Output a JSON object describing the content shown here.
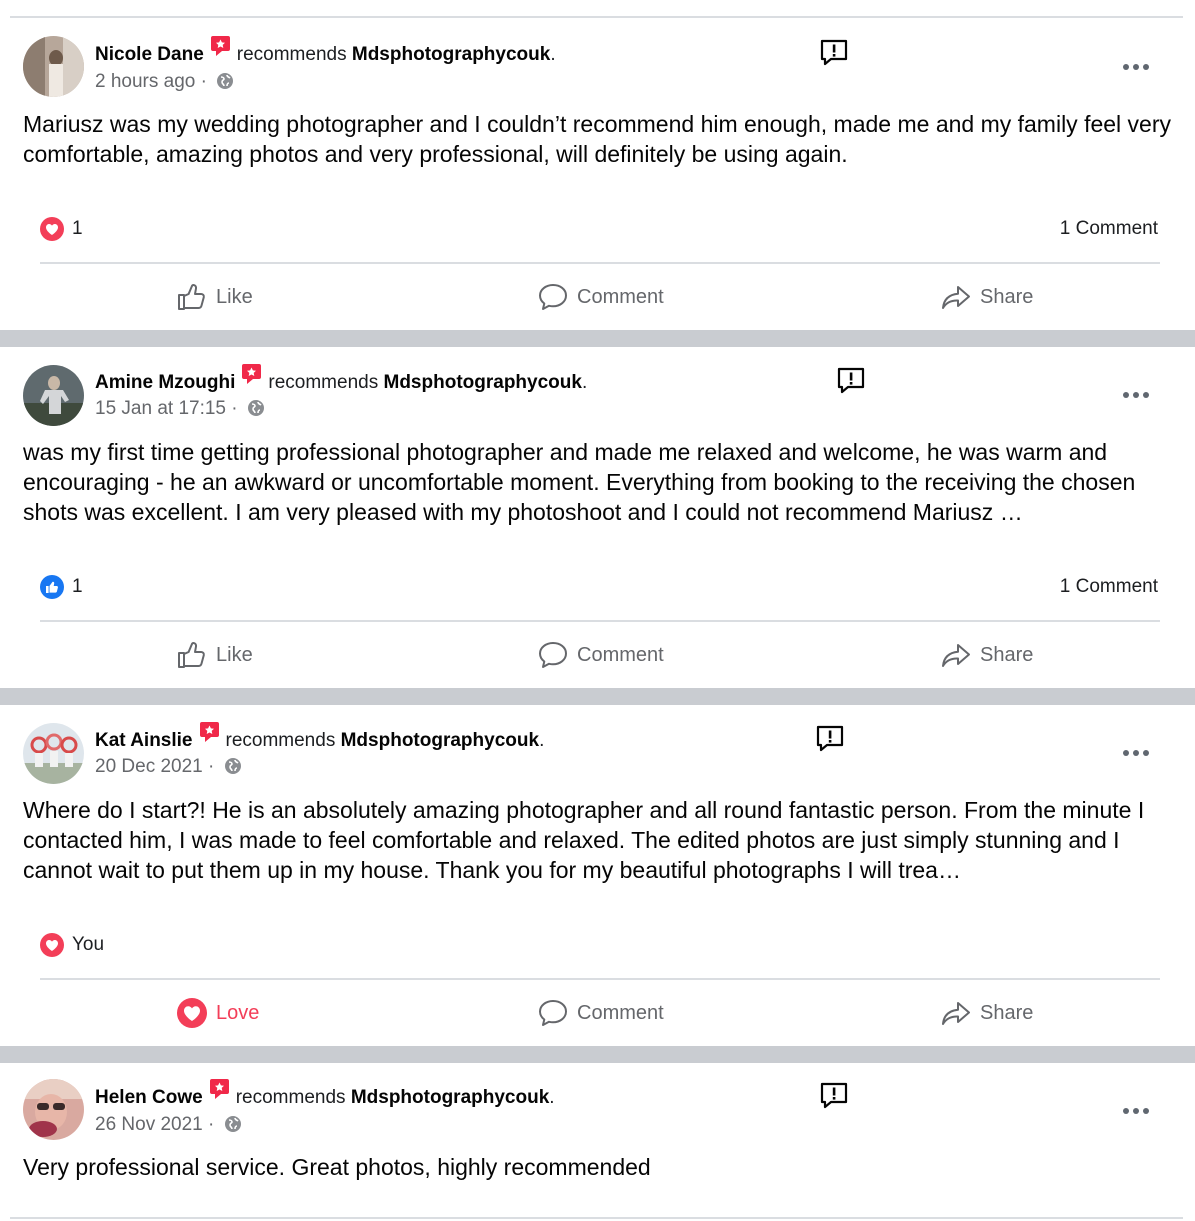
{
  "posts": [
    {
      "author": "Nicole Dane",
      "verb": "recommends",
      "page": "Mdsphotographycouk",
      "time": "2 hours ago ·",
      "text": "Mariusz was my wedding photographer and I couldn’t recommend him enough, made me and my family feel very comfortable, amazing photos and very professional, will definitely be using again.",
      "reaction_count": "1",
      "reaction_type": "love",
      "comments": "1 Comment",
      "actions": {
        "like": "Like",
        "comment": "Comment",
        "share": "Share"
      }
    },
    {
      "author": "Amine Mzoughi",
      "verb": "recommends",
      "page": "Mdsphotographycouk",
      "time": "15 Jan at 17:15 ·",
      "text": "was my first time getting professional photographer and made me relaxed and welcome, he was warm and encouraging - he an awkward or uncomfortable moment. Everything from booking to the receiving the chosen shots was excellent. I am very pleased with my photoshoot and I could not recommend Mariusz …",
      "reaction_count": "1",
      "reaction_type": "like",
      "comments": "1 Comment",
      "actions": {
        "like": "Like",
        "comment": "Comment",
        "share": "Share"
      }
    },
    {
      "author": "Kat Ainslie",
      "verb": "recommends",
      "page": "Mdsphotographycouk",
      "time": "20 Dec 2021 ·",
      "text": "Where do I start?! He is an absolutely amazing photographer and all round fantastic person. From the minute I contacted him, I was made to feel comfortable and relaxed. The edited photos are just simply stunning and I cannot wait to put them up in my house. Thank you for my beautiful photographs I will trea…",
      "reaction_count": "You",
      "reaction_type": "love",
      "comments": "",
      "actions": {
        "like": "Love",
        "comment": "Comment",
        "share": "Share"
      }
    },
    {
      "author": "Helen Cowe",
      "verb": "recommends",
      "page": "Mdsphotographycouk",
      "time": "26 Nov 2021 ·",
      "text": "Very professional service.  Great photos, highly recommended"
    }
  ],
  "colors": {
    "recommend": "#f02849",
    "love": "#f33e58",
    "like": "#1877f2",
    "secondary_text": "#65676b",
    "separator": "#c9ccd1"
  },
  "icons": {
    "recommend": "recommend-badge-icon",
    "report": "report-icon",
    "more": "more-options-icon",
    "globe": "globe-icon",
    "like": "thumbs-up-icon",
    "comment": "comment-bubble-icon",
    "share": "share-arrow-icon",
    "love": "heart-icon"
  }
}
